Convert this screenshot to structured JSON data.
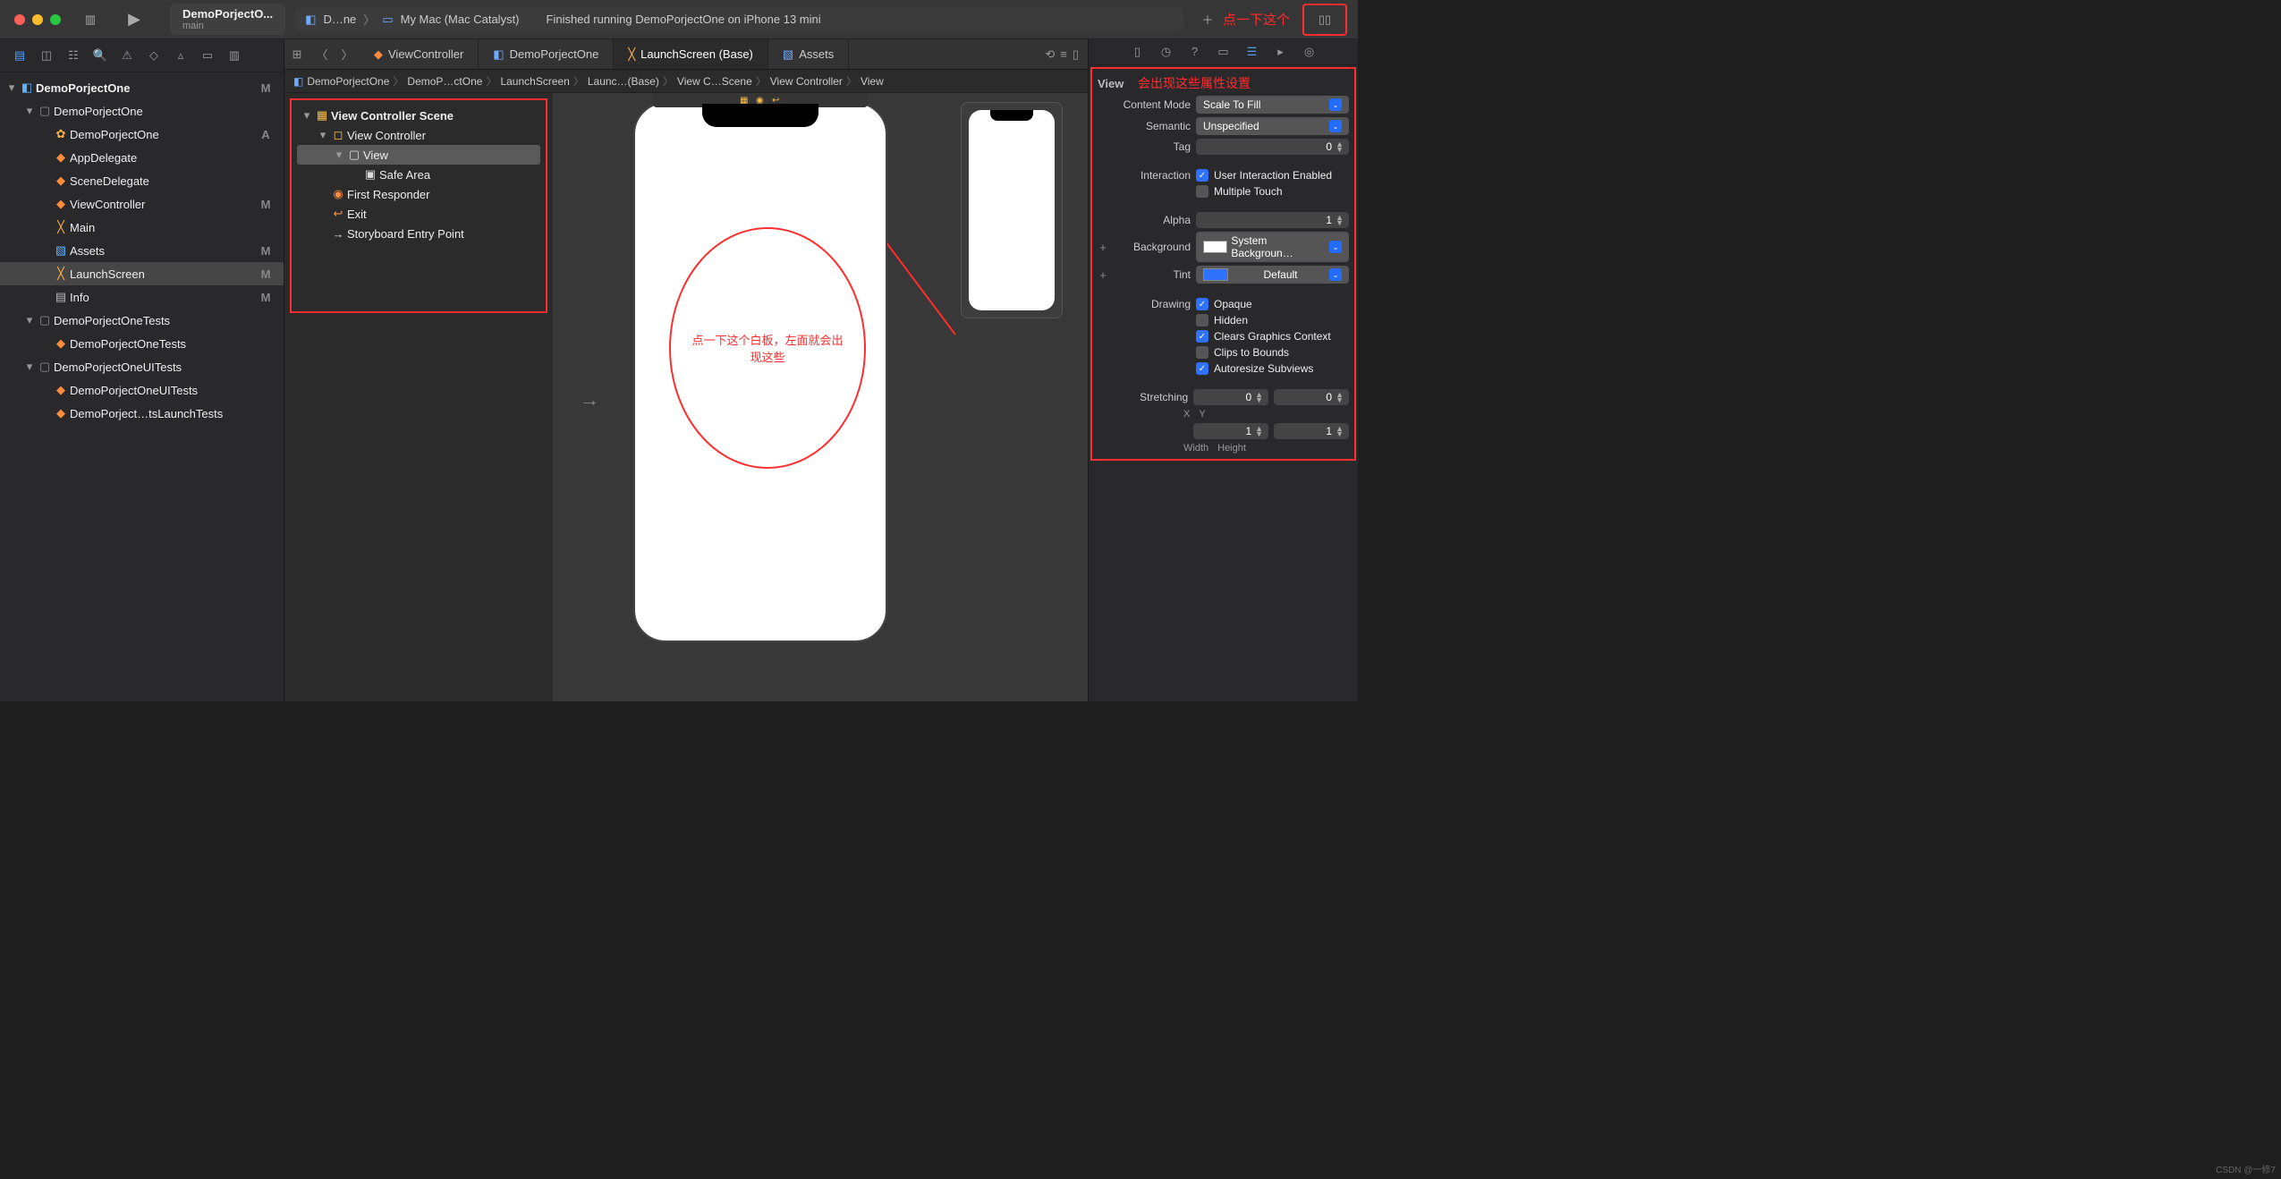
{
  "toolbar": {
    "project": "DemoPorjectO...",
    "branch": "main",
    "scheme": "D…ne",
    "device": "My Mac (Mac Catalyst)",
    "status": "Finished running DemoPorjectOne on iPhone 13 mini",
    "anno": "点一下这个"
  },
  "nav": {
    "root": {
      "label": "DemoPorjectOne",
      "badge": "M"
    },
    "items": [
      {
        "label": "DemoPorjectOne",
        "badge": "",
        "kind": "folder",
        "indent": 1,
        "disc": "▾"
      },
      {
        "label": "DemoPorjectOne",
        "badge": "A",
        "kind": "gear",
        "indent": 2
      },
      {
        "label": "AppDelegate",
        "badge": "",
        "kind": "swift",
        "indent": 2
      },
      {
        "label": "SceneDelegate",
        "badge": "",
        "kind": "swift",
        "indent": 2
      },
      {
        "label": "ViewController",
        "badge": "M",
        "kind": "swift",
        "indent": 2
      },
      {
        "label": "Main",
        "badge": "",
        "kind": "ib",
        "indent": 2
      },
      {
        "label": "Assets",
        "badge": "M",
        "kind": "assets",
        "indent": 2
      },
      {
        "label": "LaunchScreen",
        "badge": "M",
        "kind": "ib",
        "indent": 2,
        "sel": true
      },
      {
        "label": "Info",
        "badge": "M",
        "kind": "plist",
        "indent": 2
      },
      {
        "label": "DemoPorjectOneTests",
        "badge": "",
        "kind": "folder",
        "indent": 1,
        "disc": "▾"
      },
      {
        "label": "DemoPorjectOneTests",
        "badge": "",
        "kind": "swift",
        "indent": 2
      },
      {
        "label": "DemoPorjectOneUITests",
        "badge": "",
        "kind": "folder",
        "indent": 1,
        "disc": "▾"
      },
      {
        "label": "DemoPorjectOneUITests",
        "badge": "",
        "kind": "swift",
        "indent": 2
      },
      {
        "label": "DemoPorject…tsLaunchTests",
        "badge": "",
        "kind": "swift",
        "indent": 2
      }
    ]
  },
  "tabs": [
    {
      "label": "ViewController",
      "kind": "swift"
    },
    {
      "label": "DemoPorjectOne",
      "kind": "proj"
    },
    {
      "label": "LaunchScreen (Base)",
      "kind": "ib",
      "active": true
    },
    {
      "label": "Assets",
      "kind": "assets"
    }
  ],
  "jump": [
    "DemoPorjectOne",
    "DemoP…ctOne",
    "LaunchScreen",
    "Launc…(Base)",
    "View C…Scene",
    "View Controller",
    "View"
  ],
  "outline": [
    {
      "label": "View Controller Scene",
      "indent": 0,
      "disc": "▾",
      "ic": "▦",
      "col": "yel",
      "bold": true
    },
    {
      "label": "View Controller",
      "indent": 1,
      "disc": "▾",
      "ic": "◻",
      "col": "yel"
    },
    {
      "label": "View",
      "indent": 2,
      "disc": "▾",
      "ic": "▢",
      "col": "wht",
      "sel": true
    },
    {
      "label": "Safe Area",
      "indent": 3,
      "disc": "",
      "ic": "▣",
      "col": "wht"
    },
    {
      "label": "First Responder",
      "indent": 1,
      "disc": "",
      "ic": "◉",
      "col": "org"
    },
    {
      "label": "Exit",
      "indent": 1,
      "disc": "",
      "ic": "↩",
      "col": "org"
    },
    {
      "label": "Storyboard Entry Point",
      "indent": 1,
      "disc": "",
      "ic": "→",
      "col": "wht"
    }
  ],
  "canvas": {
    "oval_text": "点一下这个白板，左面就会出现这些"
  },
  "inspector": {
    "header": "View",
    "anno": "会出现这些属性设置",
    "contentMode": {
      "label": "Content Mode",
      "value": "Scale To Fill"
    },
    "semantic": {
      "label": "Semantic",
      "value": "Unspecified"
    },
    "tag": {
      "label": "Tag",
      "value": "0"
    },
    "interaction": {
      "label": "Interaction",
      "user": "User Interaction Enabled",
      "multi": "Multiple Touch"
    },
    "alpha": {
      "label": "Alpha",
      "value": "1"
    },
    "background": {
      "label": "Background",
      "value": "System Backgroun…"
    },
    "tint": {
      "label": "Tint",
      "value": "Default"
    },
    "drawing": {
      "label": "Drawing",
      "opts": [
        "Opaque",
        "Hidden",
        "Clears Graphics Context",
        "Clips to Bounds",
        "Autoresize Subviews"
      ],
      "checked": [
        true,
        false,
        true,
        false,
        true
      ]
    },
    "stretching": {
      "label": "Stretching",
      "x": "0",
      "y": "0",
      "w": "1",
      "h": "1",
      "xl": "X",
      "yl": "Y",
      "wl": "Width",
      "hl": "Height"
    }
  },
  "watermark": "CSDN @一修7"
}
